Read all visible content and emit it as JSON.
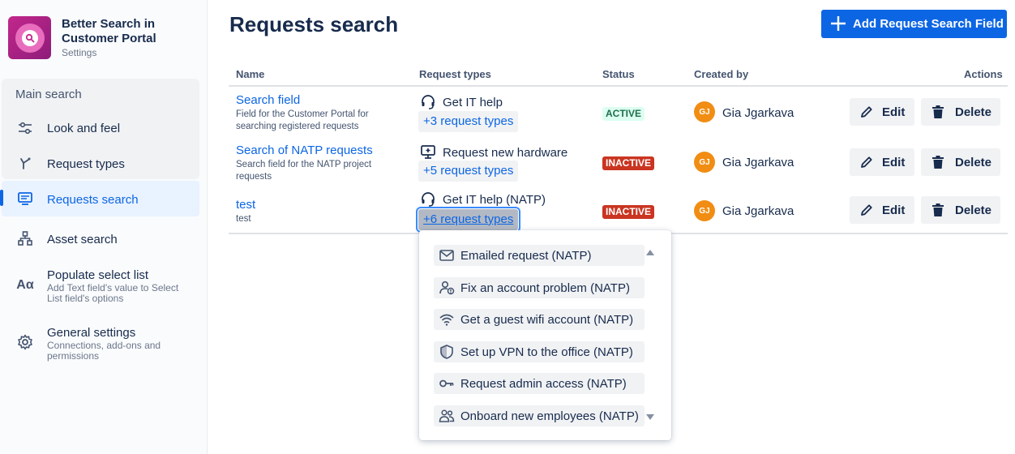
{
  "app": {
    "title": "Better Search in Customer Portal",
    "subtitle": "Settings"
  },
  "sidebar": {
    "group_title": "Main search",
    "items": [
      {
        "label": "Look and feel",
        "icon": "sliders-icon"
      },
      {
        "label": "Request types",
        "icon": "request-types-icon"
      },
      {
        "label": "Requests search",
        "icon": "monitor-search-icon",
        "active": true
      },
      {
        "label": "Asset search",
        "icon": "hierarchy-icon"
      },
      {
        "label": "Populate select list",
        "description": "Add Text field's value to Select List field's options",
        "icon": "text-aa-icon"
      },
      {
        "label": "General settings",
        "description": "Connections, add-ons and permissions",
        "icon": "gear-icon"
      }
    ]
  },
  "header": {
    "title": "Requests search",
    "add_button": "Add Request Search Field"
  },
  "table": {
    "columns": [
      "Name",
      "Request types",
      "Status",
      "Created by",
      "Actions"
    ],
    "rows": [
      {
        "name": "Search field",
        "description": "Field for the Customer Portal for searching registered requests",
        "first_type": "Get IT help",
        "first_type_icon": "headset-icon",
        "more": "+3 request types",
        "status": "ACTIVE",
        "creator_initials": "GJ",
        "creator": "Gia Jgarkava"
      },
      {
        "name": "Search of NATP requests",
        "description": "Search field for the NATP project requests",
        "first_type": "Request new hardware",
        "first_type_icon": "monitor-plus-icon",
        "more": "+5 request types",
        "status": "INACTIVE",
        "creator_initials": "GJ",
        "creator": "Gia Jgarkava"
      },
      {
        "name": "test",
        "description": "test",
        "first_type": "Get IT help (NATP)",
        "first_type_icon": "headset-icon",
        "more": "+6 request types",
        "status": "INACTIVE",
        "creator_initials": "GJ",
        "creator": "Gia Jgarkava"
      }
    ],
    "edit_label": "Edit",
    "delete_label": "Delete"
  },
  "dropdown": {
    "items": [
      {
        "label": "Emailed request (NATP)",
        "icon": "envelope-icon"
      },
      {
        "label": "Fix an account problem (NATP)",
        "icon": "user-alert-icon"
      },
      {
        "label": "Get a guest wifi account (NATP)",
        "icon": "wifi-icon"
      },
      {
        "label": "Set up VPN to the office (NATP)",
        "icon": "shield-icon"
      },
      {
        "label": "Request admin access (NATP)",
        "icon": "key-icon"
      },
      {
        "label": "Onboard new employees (NATP)",
        "icon": "people-icon"
      }
    ]
  },
  "colors": {
    "primary": "#0c66e4",
    "active_lozenge_bg": "#dcfff1",
    "inactive_lozenge_bg": "#ca3521",
    "avatar": "#f18d13",
    "app_logo": "#c2278b"
  }
}
